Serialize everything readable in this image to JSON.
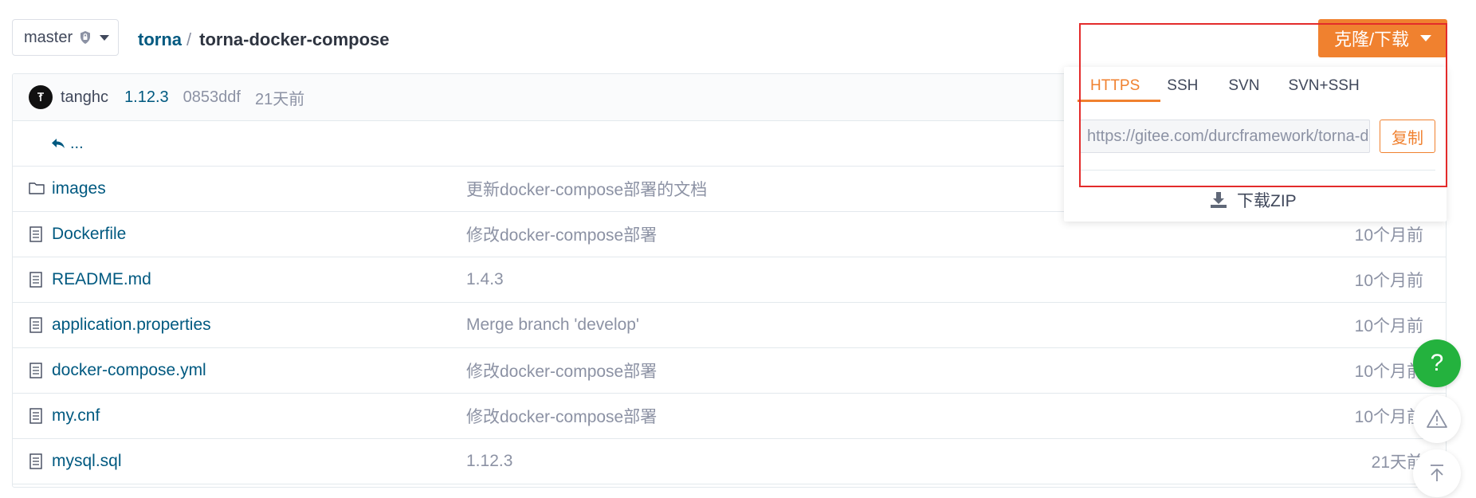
{
  "branch": {
    "name": "master"
  },
  "breadcrumb": {
    "owner": "torna",
    "separator": "/",
    "repo": "torna-docker-compose"
  },
  "commit": {
    "author": "tanghc",
    "version": "1.12.3",
    "hash": "0853ddf",
    "time": "21天前"
  },
  "back_row": {
    "label": "..."
  },
  "files": [
    {
      "type": "folder",
      "name": "images",
      "message": "更新docker-compose部署的文档",
      "time": ""
    },
    {
      "type": "file",
      "name": "Dockerfile",
      "message": "修改docker-compose部署",
      "time": "10个月前"
    },
    {
      "type": "file",
      "name": "README.md",
      "message": "1.4.3",
      "time": "10个月前"
    },
    {
      "type": "file",
      "name": "application.properties",
      "message": "Merge branch 'develop'",
      "time": "10个月前"
    },
    {
      "type": "file",
      "name": "docker-compose.yml",
      "message": "修改docker-compose部署",
      "time": "10个月前"
    },
    {
      "type": "file",
      "name": "my.cnf",
      "message": "修改docker-compose部署",
      "time": "10个月前"
    },
    {
      "type": "file",
      "name": "mysql.sql",
      "message": "1.12.3",
      "time": "21天前"
    }
  ],
  "clone": {
    "button_label": "克隆/下载",
    "tabs": [
      "HTTPS",
      "SSH",
      "SVN",
      "SVN+SSH"
    ],
    "active_tab": "HTTPS",
    "url": "https://gitee.com/durcframework/torna-docker-compose.git",
    "copy_label": "复制",
    "download_label": "下载ZIP"
  },
  "floating": {
    "help_label": "?"
  },
  "colors": {
    "accent": "#f0812f",
    "link": "#005980",
    "help": "#24b23e",
    "highlight_outline": "#e32b2b"
  }
}
